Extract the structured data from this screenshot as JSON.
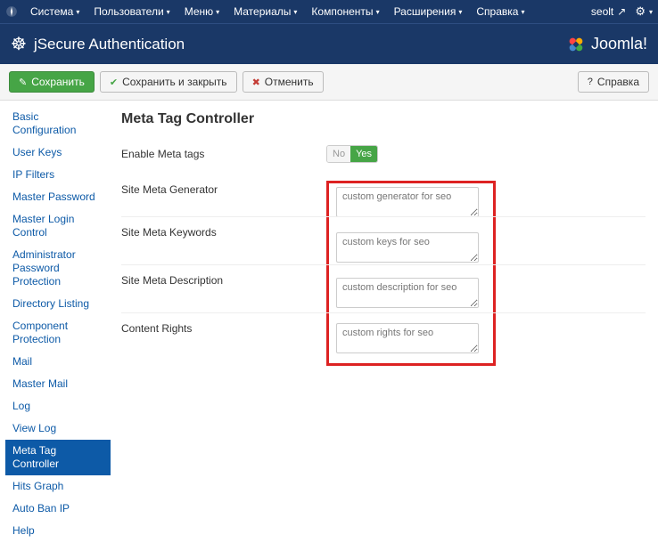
{
  "topmenu": {
    "items": [
      "Система",
      "Пользователи",
      "Меню",
      "Материалы",
      "Компоненты",
      "Расширения",
      "Справка"
    ],
    "user": "seolt",
    "caret": "▾"
  },
  "titlebar": {
    "title": "jSecure Authentication",
    "brand": "Joomla!"
  },
  "toolbar": {
    "save": "Сохранить",
    "save_close": "Сохранить и закрыть",
    "cancel": "Отменить",
    "help": "Справка"
  },
  "sidebar": {
    "items": [
      "Basic Configuration",
      "User Keys",
      "IP Filters",
      "Master Password",
      "Master Login Control",
      "Administrator Password Protection",
      "Directory Listing",
      "Component Protection",
      "Mail",
      "Master Mail",
      "Log",
      "View Log",
      "Meta Tag Controller",
      "Hits Graph",
      "Auto Ban IP",
      "Help"
    ],
    "active_index": 12
  },
  "page": {
    "heading": "Meta Tag Controller",
    "fields": {
      "enable_label": "Enable Meta tags",
      "enable_no": "No",
      "enable_yes": "Yes",
      "generator_label": "Site Meta Generator",
      "generator_value": "custom generator for seo",
      "keywords_label": "Site Meta Keywords",
      "keywords_value": "custom keys for seo",
      "description_label": "Site Meta Description",
      "description_value": "custom description for seo",
      "rights_label": "Content Rights",
      "rights_value": "custom rights for seo"
    }
  }
}
